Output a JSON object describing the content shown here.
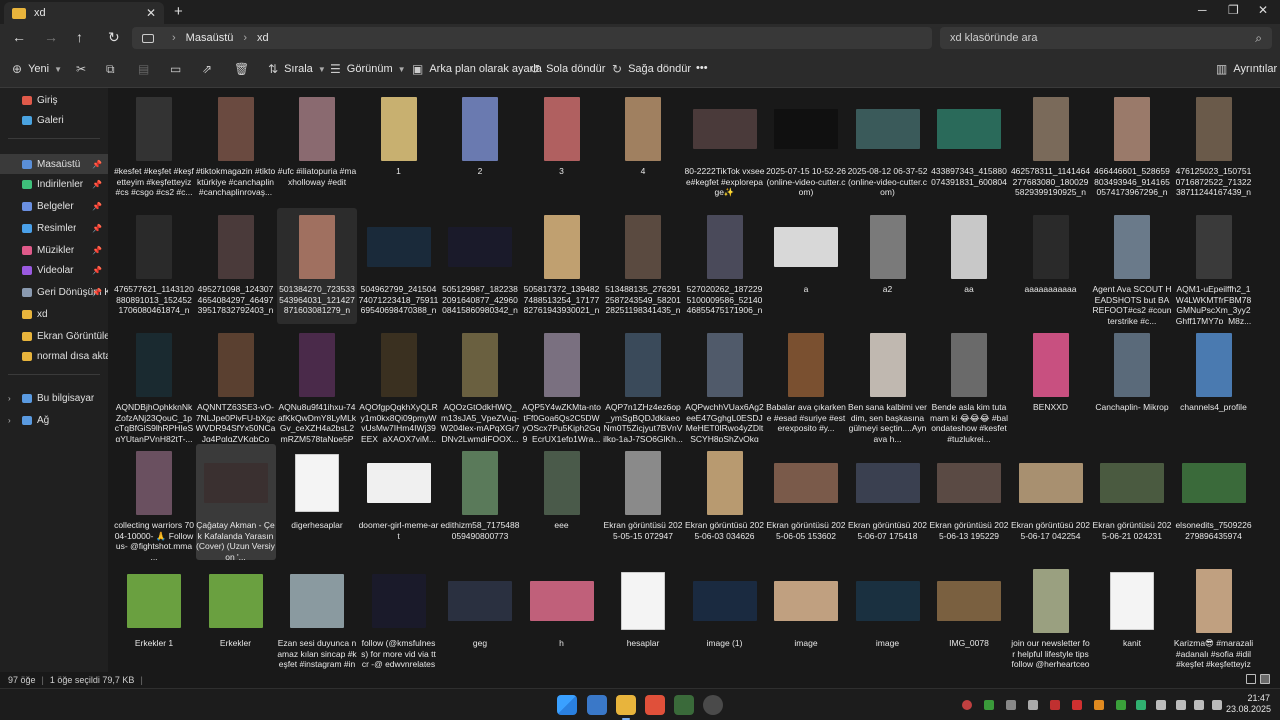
{
  "tab": {
    "title": "xd",
    "close": "✕",
    "new": "+"
  },
  "window": {
    "minimize": "─",
    "maximize": "❐",
    "close": "✕"
  },
  "nav": {
    "back": "←",
    "forward": "→",
    "up": "↑",
    "refresh": "↻",
    "crumb_root": "Masaüstü",
    "crumb_current": "xd",
    "crumb_sep": "›",
    "search_placeholder": "xd klasöründe ara"
  },
  "toolbar": {
    "new": "Yeni",
    "sort": "Sırala",
    "view": "Görünüm",
    "set_bg": "Arka plan olarak ayarla",
    "rotate_left": "Sola döndür",
    "rotate_right": "Sağa döndür",
    "more": "•••",
    "details": "Ayrıntılar"
  },
  "sidebar": {
    "items": [
      {
        "label": "Giriş",
        "icon": "home-icon",
        "color": "#e05a4a"
      },
      {
        "label": "Galeri",
        "icon": "gallery-icon",
        "color": "#4aa3e0"
      },
      {
        "label": "Masaüstü",
        "icon": "desktop-icon",
        "color": "#5a8fd8"
      },
      {
        "label": "İndirilenler",
        "icon": "download-icon",
        "color": "#3ec07a"
      },
      {
        "label": "Belgeler",
        "icon": "documents-icon",
        "color": "#6a8fe0"
      },
      {
        "label": "Resimler",
        "icon": "pictures-icon",
        "color": "#4aa0e8"
      },
      {
        "label": "Müzikler",
        "icon": "music-icon",
        "color": "#e05a8a"
      },
      {
        "label": "Videolar",
        "icon": "videos-icon",
        "color": "#9a5ae0"
      },
      {
        "label": "Geri Dönüşüm K",
        "icon": "recycle-bin-icon",
        "color": "#8a9ab0"
      },
      {
        "label": "xd",
        "icon": "folder-icon",
        "color": "#e8b43c"
      },
      {
        "label": "Ekran Görüntüleri",
        "icon": "folder-icon",
        "color": "#e8b43c"
      },
      {
        "label": "normal dısa aktarm",
        "icon": "folder-icon",
        "color": "#e8b43c"
      },
      {
        "label": "Bu bilgisayar",
        "icon": "this-pc-icon",
        "color": "#5a9ae0"
      },
      {
        "label": "Ağ",
        "icon": "network-icon",
        "color": "#5a9ae0"
      }
    ],
    "pin": "📌",
    "chevron": "›"
  },
  "files": [
    {
      "name": "#kesfet #keşfet #keşfetteyim #keşfetteyiz #cs #csgo #cs2 #c...",
      "color": "#333333"
    },
    {
      "name": "#tiktokmagazin #tiktoktürkiye #canchaplin #canchaplinrovaş...",
      "color": "#6a4a40"
    },
    {
      "name": "#ufc #iliatopuria #maxholloway #edit",
      "color": "#8a6a70"
    },
    {
      "name": "1",
      "color": "#c8b070"
    },
    {
      "name": "2",
      "color": "#6a7ab0"
    },
    {
      "name": "3",
      "color": "#b06060"
    },
    {
      "name": "4",
      "color": "#a08060"
    },
    {
      "name": "80-2222TikTok vxseee#kegfet #explorepage✨",
      "color": "#4a3a3a"
    },
    {
      "name": "2025-07-15 10-52-26 (online-video-cutter.com)",
      "color": "#101010"
    },
    {
      "name": "2025-08-12 06-37-52 (online-video-cutter.com)",
      "color": "#3a5a5a"
    },
    {
      "name": "433897343_415880074391831_600804",
      "color": "#2a6a5a"
    },
    {
      "name": "462578311_1141464277683080_1800295829399190925_n",
      "color": "#7a6a5a"
    },
    {
      "name": "466446601_528659803493946_9141650574173967296_n",
      "color": "#9a7a6a"
    },
    {
      "name": "476125023_1507510716872522_7132238711244167439_n",
      "color": "#6a5a4a"
    },
    {
      "name": "476577621_1143120880891013_1524521706080461874_n",
      "color": "#2a2a2a"
    },
    {
      "name": "495271098_1243074654084297_4649739517832792403_n",
      "color": "#4a3a3a"
    },
    {
      "name": "501384270_723533543964031_121427871603081279_n",
      "color": "#a07060"
    },
    {
      "name": "504962799_24150474071223418_7591169540698470388_n",
      "color": "#1a2a3a"
    },
    {
      "name": "505129987_1822382091640877_4296008415860980342_n",
      "color": "#1a1a2a"
    },
    {
      "name": "505817372_1394827488513254_1717782761943930021_n",
      "color": "#c0a070"
    },
    {
      "name": "513488135_2762912587243549_5820128251198341435_n",
      "color": "#5a4a40"
    },
    {
      "name": "527020262_1872295100009586_5214046855475171906_n",
      "color": "#4a4a5a"
    },
    {
      "name": "a",
      "color": "#d8d8d8"
    },
    {
      "name": "a2",
      "color": "#7a7a7a"
    },
    {
      "name": "aa",
      "color": "#c8c8c8"
    },
    {
      "name": "aaaaaaaaaaa",
      "color": "#2a2a2a"
    },
    {
      "name": "Agent Ava SCOUT HEADSHOTS but BAREFOOT#cs2 #counterstrike #c...",
      "color": "#6a7a8a"
    },
    {
      "name": "AQM1-uEpeilffh2_1W4LWKMTfrFBM78GMNuPscXm_3yy2Ghff17MY7p_M8z...",
      "color": "#3a3a3a"
    },
    {
      "name": "AQNDBjhOphkknNkZofzANj23QouC_1pcTqBfGiS9lhRPHIeSgYUtanPVnH82tT-...",
      "color": "#1a2a30"
    },
    {
      "name": "AQNNTZ63SE3-vO-7NLJpe0PivFU-bXgcWVDR94SfYx50NCaJg4PglqZVKgbCoC...",
      "color": "#5a4030"
    },
    {
      "name": "AQNu8u9f41ihxu-74afKkQwDmY8LyMLkGv_ceXZH4a2bsL2mRZM578taNpe5Ph...",
      "color": "#4a2a4a"
    },
    {
      "name": "AQOfgpQqkhXyQLRy1m0kx8Qi09pmyWvUsMw7IHm4IWj39EEX_aXAOX7vjM...",
      "color": "#3a3020"
    },
    {
      "name": "AQOzGtOdkHWQ_m13sJA5_VpeZVuq-W204lex-mAPqXGr7DNy2LwmdjFQOX...",
      "color": "#6a6040"
    },
    {
      "name": "AQP5Y4wZKMta-ntotFf0Goa6Qs2C5DWyOScx7Pu5Kiph2Gq9_EcrUX1efp1Wra...",
      "color": "#7a7080"
    },
    {
      "name": "AQP7n1ZHz4ez6op_ymSgBQDJdkiaeoNm0T5Zicjyut7BVnVjlkp-1aJ-7SO6GlKh...",
      "color": "#3a4a5a"
    },
    {
      "name": "AQPwchhVUax6Ag2eeE47GghgL0ESDJMeHET0IRwo4yZDltSCYH8pShZvQkgm...",
      "color": "#505a6a"
    },
    {
      "name": "Babalar ava çıkarkene #esad #suriye #esterexposito #y...",
      "color": "#7a5030"
    },
    {
      "name": "Ben sana kalbimi verdim, sen başkasına gülmeyi seçtin....Aynaya h...",
      "color": "#c0b8b0"
    },
    {
      "name": "Bende asla kim tutamam ki 😂😂😂 #balondateshow #kesfet #tuzlukrei...",
      "color": "#6a6a6a"
    },
    {
      "name": "BENXXD",
      "color": "#c85080"
    },
    {
      "name": "Canchaplin- Mikrop",
      "color": "#5a6a7a"
    },
    {
      "name": "channels4_profile",
      "color": "#4a7ab0"
    },
    {
      "name": "collecting warriors 7004-10000- 🙏 Follow us- @fightshot.mma ...",
      "color": "#6a5060"
    },
    {
      "name": "Çağatay Akman - Çek Kafalanda Yarasın (Cover) (Uzun Versiyon '...",
      "color": "#3a3030"
    },
    {
      "name": "digerhesaplar",
      "color": "#f4f4f4"
    },
    {
      "name": "doomer-girl-meme-art",
      "color": "#f0f0f0"
    },
    {
      "name": "edithizm58_7175488059490800773",
      "color": "#5a7a5a"
    },
    {
      "name": "eee",
      "color": "#4a5a4a"
    },
    {
      "name": "Ekran görüntüsü 2025-05-15 072947",
      "color": "#8a8a8a"
    },
    {
      "name": "Ekran görüntüsü 2025-06-03 034626",
      "color": "#b89a70"
    },
    {
      "name": "Ekran görüntüsü 2025-06-05 153602",
      "color": "#7a5a4a"
    },
    {
      "name": "Ekran görüntüsü 2025-06-07 175418",
      "color": "#3a4050"
    },
    {
      "name": "Ekran görüntüsü 2025-06-13 195229",
      "color": "#5a4a44"
    },
    {
      "name": "Ekran görüntüsü 2025-06-17 042254",
      "color": "#a89070"
    },
    {
      "name": "Ekran görüntüsü 2025-06-21 024231",
      "color": "#4a5a40"
    },
    {
      "name": "elsonedits_7509226279896435974",
      "color": "#3a6a3a"
    },
    {
      "name": "Erkekler 1",
      "color": "#6aa040"
    },
    {
      "name": "Erkekler",
      "color": "#6aa040"
    },
    {
      "name": "Ezan sesi duyunca namaz kılan sincap #keşfet #instagram #instagramreels #...",
      "color": "#8a9aa0"
    },
    {
      "name": "follow (@kmsfulness) for more vid via tt cr -@ edwvnrelates",
      "color": "#1a1a2a"
    },
    {
      "name": "geg",
      "color": "#2a3040"
    },
    {
      "name": "h",
      "color": "#c0607a"
    },
    {
      "name": "hesaplar",
      "color": "#f4f4f4"
    },
    {
      "name": "image (1)",
      "color": "#1a2a40"
    },
    {
      "name": "image",
      "color": "#c0a080"
    },
    {
      "name": "image",
      "color": "#1a3040"
    },
    {
      "name": "IMG_0078",
      "color": "#7a6040"
    },
    {
      "name": "join our newsletter for helpful lifestyle tips follow @herheartceo",
      "color": "#9aa080"
    },
    {
      "name": "kanit",
      "color": "#f4f4f4"
    },
    {
      "name": "Karizma😎 #marazali #adanalı #sofia #idil #keşfet #keşfetteyiz",
      "color": "#c0a080"
    }
  ],
  "status": {
    "count": "97 öğe",
    "selected": "1 öğe seçildi 79,7 KB",
    "sep": "|"
  },
  "taskbar": {
    "time": "21:47",
    "date": "23.08.2025"
  }
}
